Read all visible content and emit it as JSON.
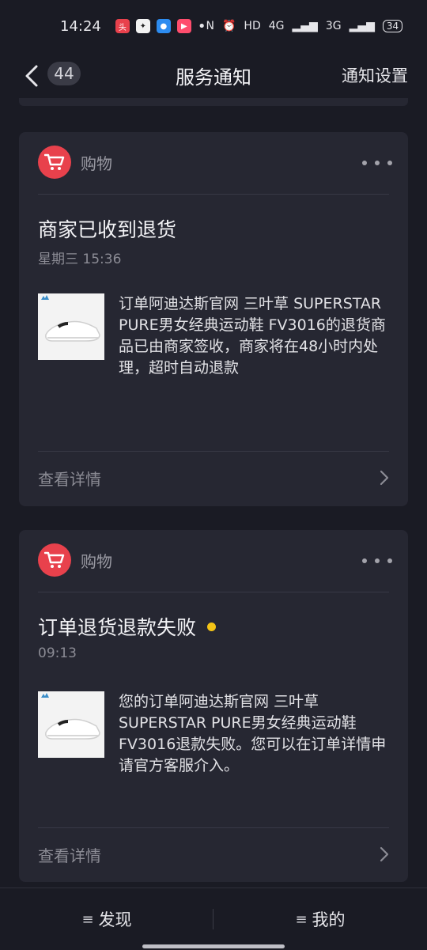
{
  "status_bar": {
    "time": "14:24",
    "right_text": "HD",
    "battery": "34",
    "signal_labels": [
      "4G",
      "3G"
    ]
  },
  "header": {
    "back_icon": "chevron-left-icon",
    "unread_count": "44",
    "title": "服务通知",
    "settings_label": "通知设置"
  },
  "notifications": [
    {
      "category": "购物",
      "category_icon": "shopping-cart-icon",
      "title": "商家已收到退货",
      "time": "星期三 15:36",
      "unread": false,
      "body": "订单阿迪达斯官网 三叶草 SUPERSTAR PURE男女经典运动鞋 FV3016的退货商品已由商家签收，商家将在48小时内处理，超时自动退款",
      "detail_label": "查看详情"
    },
    {
      "category": "购物",
      "category_icon": "shopping-cart-icon",
      "title": "订单退货退款失败",
      "time": "09:13",
      "unread": true,
      "body": "您的订单阿迪达斯官网 三叶草 SUPERSTAR PURE男女经典运动鞋 FV3016退款失败。您可以在订单详情申请官方客服介入。",
      "detail_label": "查看详情"
    }
  ],
  "bottom_nav": {
    "left_label": "发现",
    "right_label": "我的"
  },
  "colors": {
    "background": "#1a1b24",
    "card": "#262732",
    "accent_red": "#e8414c",
    "unread_dot": "#f3c316"
  }
}
